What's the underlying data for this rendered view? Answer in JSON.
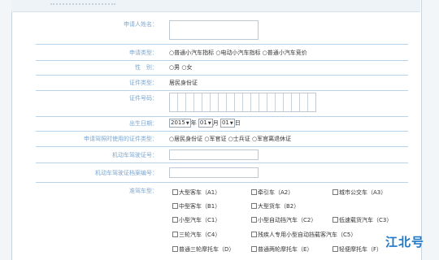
{
  "form": {
    "name_label": "申请人姓名：",
    "type_label": "申请类型：",
    "type_options": "○普通小汽车指标 ○电动小汽车指标 ○普通小汽车竞价",
    "gender_label": "性　别：",
    "gender_options": "○男 ○女",
    "cert_type_label": "证件类型：",
    "cert_type_value": "居民身份证",
    "cert_no_label": "证件号码：",
    "birth_label": "出生日期：",
    "birth_year": "2015",
    "birth_year_suffix": "年",
    "birth_month": "01",
    "birth_month_suffix": "月",
    "birth_day": "01",
    "birth_day_suffix": "日",
    "apply_cert_label": "申请驾照时使用的证件类型：",
    "apply_cert_options": "○居民身份证 ○军官证 ○士兵证 ○军官离退休证",
    "license_no_label": "机动车驾驶证号：",
    "license_file_label": "机动车驾驶证档案编号：",
    "vehicle_type_label": "准驾车型：",
    "vehicle_types": [
      "大型客车（A1）",
      "牵引车（A2）",
      "城市公交车（A3）",
      "中型客车（B1）",
      "大型货车（B2）",
      "小型汽车（C1）",
      "小型自动挡汽车（C2）",
      "低速载货汽车（C3）",
      "三轮汽车（C4）",
      "残疾人专用小型自动挡载客汽车（C5）",
      "普通三轮摩托车（D）",
      "普通两轮摩托车（E）",
      "轻便摩托车（F）"
    ]
  },
  "watermark": "江北号"
}
